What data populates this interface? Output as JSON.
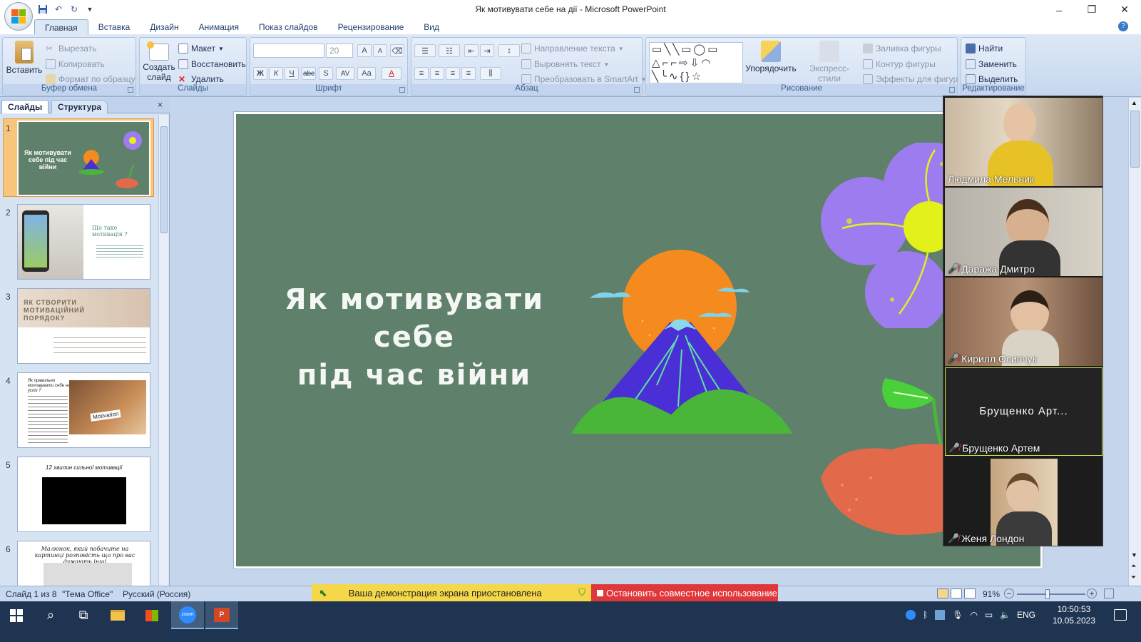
{
  "window": {
    "title": "Як мотивувати себе на дії - Microsoft PowerPoint",
    "minimize": "–",
    "maximize": "❐",
    "close": "✕"
  },
  "tabs": [
    "Главная",
    "Вставка",
    "Дизайн",
    "Анимация",
    "Показ слайдов",
    "Рецензирование",
    "Вид"
  ],
  "ribbon": {
    "clipboard": {
      "label": "Буфер обмена",
      "paste": "Вставить",
      "cut": "Вырезать",
      "copy": "Копировать",
      "format_painter": "Формат по образцу"
    },
    "slides": {
      "label": "Слайды",
      "new_slide": "Создать слайд",
      "layout": "Макет",
      "reset": "Восстановить",
      "delete": "Удалить"
    },
    "font": {
      "label": "Шрифт",
      "size": "20",
      "bold": "Ж",
      "italic": "К",
      "underline": "Ч",
      "strike": "abc",
      "shadow": "S",
      "spacing": "AV",
      "case": "Aa",
      "color": "A",
      "grow": "A",
      "shrink": "A"
    },
    "paragraph": {
      "label": "Абзац",
      "text_direction": "Направление текста",
      "align_text": "Выровнять текст",
      "smartart": "Преобразовать в SmartArt"
    },
    "drawing": {
      "label": "Рисование",
      "arrange": "Упорядочить",
      "quick_styles": "Экспресс-стили",
      "shape_fill": "Заливка фигуры",
      "shape_outline": "Контур фигуры",
      "shape_effects": "Эффекты для фигур"
    },
    "editing": {
      "label": "Редактирование",
      "find": "Найти",
      "replace": "Заменить",
      "select": "Выделить"
    }
  },
  "pane": {
    "tab_slides": "Слайды",
    "tab_outline": "Структура",
    "close": "×",
    "thumbs": [
      {
        "num": "1",
        "title": "Як мотивувати себе під час війни"
      },
      {
        "num": "2",
        "title": "Що таке мотивація ?"
      },
      {
        "num": "3",
        "title": "ЯК СТВОРИТИ МОТИВАЦІЙНИЙ ПОРЯДОК?"
      },
      {
        "num": "4",
        "title": "Як правильно мотивувати себе на успіх ?",
        "badge": "Motivation"
      },
      {
        "num": "5",
        "title": "12 хвилин сильної мотивації"
      },
      {
        "num": "6",
        "title": "Малюнок, який побачите на картинці розповість що про вас думають інші"
      }
    ]
  },
  "slide": {
    "title": "Як мотивувати\nсебе\nпід час війни"
  },
  "video": {
    "participants": [
      {
        "name": "Людмила Мельник",
        "muted": false
      },
      {
        "name": "Даража Дмитро",
        "muted": true
      },
      {
        "name": "Кирилл Осипчук",
        "muted": true
      },
      {
        "name": "Брущенко Артем",
        "muted": true,
        "tile_label": "Брущенко Арт..."
      },
      {
        "name": "Женя Лондон",
        "muted": true
      }
    ]
  },
  "status": {
    "slide_info": "Слайд 1 из 8",
    "theme": "\"Тема Office\"",
    "language": "Русский (Россия)",
    "zoom": "91%"
  },
  "zoom_bar": {
    "paused": "Ваша демонстрация экрана приостановлена",
    "stop": "Остановить совместное использование"
  },
  "taskbar": {
    "zoom_app": "zoom",
    "lang": "ENG",
    "time": "10:50:53",
    "date": "10.05.2023"
  },
  "colors": {
    "slide_bg": "#5f806a",
    "sun": "#f58a1f",
    "mountain": "#4a2fd6",
    "hill": "#49b63a",
    "flower": "#9d7cf0",
    "flower_center": "#e4f01a"
  }
}
